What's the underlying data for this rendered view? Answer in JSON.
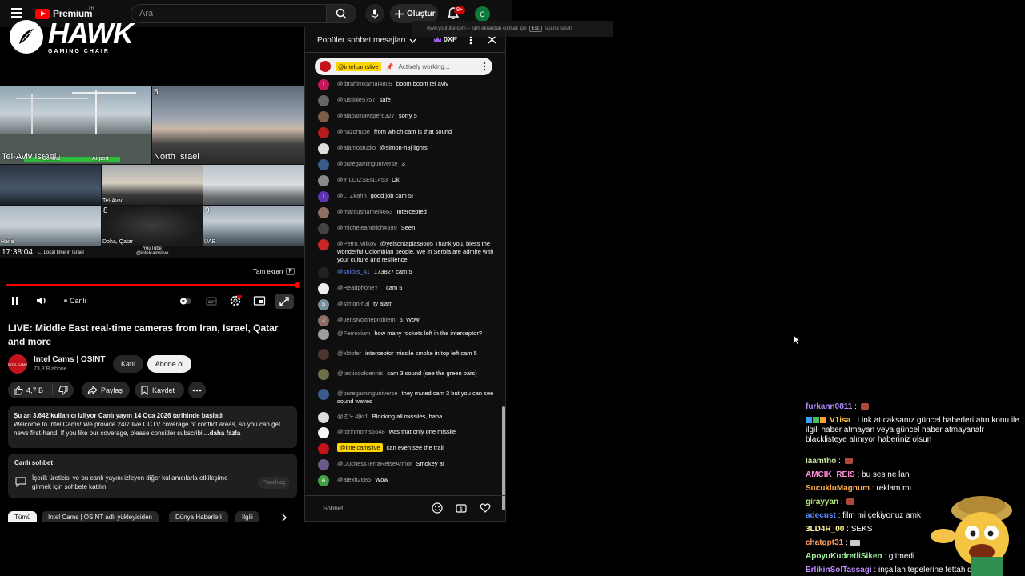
{
  "topbar": {
    "logo_word": "Premium",
    "logo_region": "TR",
    "search_placeholder": "Ara",
    "create_label": "Oluştur",
    "notification_count": "9+",
    "avatar_letter": "C"
  },
  "sponsor_logo": {
    "word": "HAWK",
    "sub": "GAMING CHAIR"
  },
  "video": {
    "cams": [
      {
        "label": "Tel-Aviv Israel"
      },
      {
        "label": "Central"
      },
      {
        "label": "Airport"
      },
      {
        "label": "North Israel"
      },
      {
        "label": "Tel-Aviv"
      },
      {
        "label": "Haifa"
      },
      {
        "label": "Doha, Qatar"
      },
      {
        "label": "UAE"
      }
    ],
    "cam_number_5": "5",
    "cam_number_8": "8",
    "cam_number_9": "9",
    "clock": "17:38:04",
    "clock_note": "← Local time in Israel",
    "watermark_line1": "YouTube",
    "watermark_line2": "@intelcamslive",
    "fullscreen_tip": "Tam ekran",
    "fullscreen_key": "F",
    "progress": 1.0,
    "live_label": "Canlı"
  },
  "info": {
    "title": "LIVE: Middle East real-time cameras from Iran, Israel, Qatar and more",
    "channel_name": "Intel Cams | OSINT",
    "channel_subs": "73,8 B abone",
    "join_label": "Katıl",
    "subscribe_label": "Abone ol",
    "like_count": "4,7 B",
    "share_label": "Paylaş",
    "save_label": "Kaydet"
  },
  "description": {
    "head": "Şu an 3.642 kullanıcı izliyor  Canlı yayın 14 Oca 2026 tarihinde başladı",
    "body": "Welcome to Intel Cams! We provide 24/7 live CCTV coverage of conflict areas, so you can get news first-hand! If you like our coverage, please consider subscribi",
    "more": "...daha fazla"
  },
  "live_chat_card": {
    "title": "Canlı sohbet",
    "body": "İçerik üreticisi ve bu canlı yayını izleyen diğer kullanıcılarla etkileşime girmek için sohbete katılın.",
    "button": "Paneli aç"
  },
  "chips": [
    {
      "label": "Tümü",
      "active": true
    },
    {
      "label": "Intel Cams | OSINT adlı yükleyiciden",
      "active": false
    },
    {
      "label": "Dünya Haberleri",
      "active": false
    },
    {
      "label": "İlgili",
      "active": false
    }
  ],
  "chat": {
    "header_title": "Popüler sohbet mesajları",
    "xp": "0XP",
    "pinned_author": "@intelcamslive",
    "pinned_text": "Actively working...",
    "input_placeholder": "Sohbet...",
    "messages": [
      {
        "author": "@ibrahimkamal4809",
        "text": "boom boom tel aviv",
        "color": "#c2185b",
        "initial": "i"
      },
      {
        "author": "@justinle5757",
        "text": "safe",
        "color": "#666666",
        "initial": ""
      },
      {
        "author": "@alabamavaper6327",
        "text": "sorry 5",
        "color": "#7b5e4a",
        "initial": ""
      },
      {
        "author": "@nazortube",
        "text": "from which cam is that sound",
        "color": "#b71c1c",
        "initial": ""
      },
      {
        "author": "@alamostudio",
        "text": "@simon-h3j lights",
        "color": "#dddddd",
        "initial": ""
      },
      {
        "author": "@puregaminguniverse",
        "text": "3",
        "color": "#3a5a8a",
        "initial": ""
      },
      {
        "author": "@YILDIZSEN1453",
        "text": "Ok.",
        "color": "#8a8a8a",
        "initial": ""
      },
      {
        "author": "@LTZkahn",
        "text": "good job cam 5!",
        "color": "#5e35b1",
        "initial": "T"
      },
      {
        "author": "@marcushamel4663",
        "text": "Intercepted",
        "color": "#8d6e63",
        "initial": ""
      },
      {
        "author": "@micheleandrich4599",
        "text": "Seen",
        "color": "#444444",
        "initial": ""
      },
      {
        "author": "@Petro.Milkov",
        "text": "@yeisontapias8605 Thank you, bless the wonderful Colombian people. We in Serbia are admire with your culture and resilience",
        "color": "#c62828",
        "initial": ""
      },
      {
        "author": "@snicks_41",
        "text": "173827 cam 5",
        "color": "#222222",
        "initial": "",
        "mod": true
      },
      {
        "author": "@HeadphoneYT",
        "text": "cam 5",
        "color": "#eeeeee",
        "initial": ""
      },
      {
        "author": "@simon-h3j",
        "text": "ty alam",
        "color": "#78909c",
        "initial": "S"
      },
      {
        "author": "@JensNottheproblem",
        "text": "5. Wow",
        "color": "#8d6e63",
        "initial": "J"
      },
      {
        "author": "@Ferroxium",
        "text": "how many rockets left in the interceptor?",
        "color": "#9e9e9e",
        "initial": ""
      },
      {
        "author": "@xktofer",
        "text": "interceptor missile smoke in top left cam 5",
        "color": "#4e342e",
        "initial": ""
      },
      {
        "author": "@tacticooldennis",
        "text": "cam 3 sound (see the green bars)",
        "color": "#6d6d4a",
        "initial": ""
      },
      {
        "author": "@puregaminguniverse",
        "text": "they muted cam 3 but you can see sound waves",
        "color": "#3a5a8a",
        "initial": ""
      },
      {
        "author": "@번도제kr1",
        "text": "Blocking all missiles, haha.",
        "color": "#dddddd",
        "initial": ""
      },
      {
        "author": "@torinmorris6648",
        "text": "was that only one missile",
        "color": "#f5f5f5",
        "initial": ""
      },
      {
        "author": "@intelcamslive",
        "text": "can even see the trail",
        "color": "#c4121a",
        "initial": "",
        "owner": true
      },
      {
        "author": "@DuchessTerraReiseArmor",
        "text": "Smokey af",
        "color": "#6a5a8a",
        "initial": ""
      },
      {
        "author": "@alexb2685",
        "text": "Wow",
        "color": "#43a047",
        "initial": "A"
      }
    ]
  },
  "fs_hint": {
    "prefix": "www.youtube.com – Tam ekrandan çıkmak için",
    "key": "Esc",
    "suffix": "tuşuna basın"
  },
  "overlay_chat": [
    {
      "user": "furkann0811",
      "text": "",
      "color": "#b58cff"
    },
    {
      "user": "V1isa",
      "text": "Link atıcaksanız güncel haberleri atın konu ile ilgili haber atmayan veya güncel haber atmayanalr blacklisteye alınıyor haberiniz olsun",
      "color": "#ffbf40"
    },
    {
      "user": "Iaamtho",
      "text": "",
      "color": "#c9e4a3"
    },
    {
      "user": "AMCIK_REIS",
      "text": "bu ses ne lan",
      "color": "#ff8cd6"
    },
    {
      "user": "SucukluMagnum",
      "text": "reklam mı",
      "color": "#ffb04a"
    },
    {
      "user": "girayyan",
      "text": "",
      "color": "#b3e680"
    },
    {
      "user": "adecust",
      "text": "film mi çekiyonuz amk",
      "color": "#5a8cff"
    },
    {
      "user": "3LD4R_00",
      "text": "SEKS",
      "color": "#fff6a0"
    },
    {
      "user": "chatgpt31",
      "text": "",
      "color": "#ffa060"
    },
    {
      "user": "ApoyuKudretliSiken",
      "text": "gitmedi",
      "color": "#a0f0a0"
    },
    {
      "user": "ErlikinSolTassagi",
      "text": "inşallah tepelerine fettah düşer",
      "color": "#c18cff"
    }
  ]
}
